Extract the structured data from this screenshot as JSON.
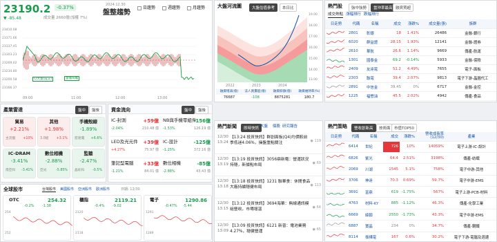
{
  "colors": {
    "up": "#e5363b",
    "down": "#1a9b4b",
    "link": "#1a56a8"
  },
  "index": {
    "value": "23190.2",
    "change_pct": "-0.37%",
    "change": "▼ -85.48",
    "volume": "成交量 2660億(加權 7%)",
    "date": "2024.12.30",
    "trend": "盤整趨勢",
    "checkboxes": [
      "日趨勢",
      "週趨勢",
      "月趨勢"
    ],
    "yticks": [
      "23410.08",
      "23371.66",
      "23337.45",
      "23303.23",
      "23269.02",
      "23234.80",
      "23200.58",
      "23166.37",
      "23132.16"
    ],
    "xticks": [
      "09:00",
      "11:00",
      "12:00",
      "13:00"
    ],
    "callouts": [
      "CI大量(成交)",
      "量價背離"
    ]
  },
  "money": {
    "title": "大盤河流圖",
    "tabs": [
      "大盤估值參考",
      "本日比"
    ],
    "xticks": [
      "2022",
      "2023",
      "2024"
    ],
    "pe_values": [
      "19.00",
      "18.00",
      "17.00",
      "16.00",
      "15.00",
      "14.00",
      "13.00"
    ],
    "headers": [
      "融資增減(億)",
      "法人買賣超(億)",
      "融資餘額(億)",
      "融資維持率(%)"
    ],
    "values": [
      "76687",
      "-108",
      "8875281",
      "180.7"
    ],
    "note": "資料日期: 2024/12"
  },
  "hot_stocks": {
    "title": "熱門股",
    "tabs": [
      "強中強勢",
      "當沖率最高",
      "融資買超"
    ],
    "subtabs": [
      "成交熱點",
      "漲幅排行",
      "跌幅排行"
    ],
    "headers": [
      "日走勢",
      "代碼",
      "名稱",
      "成交",
      "漲跌%",
      "成交量(張)",
      "族群"
    ],
    "rows": [
      [
        "2801",
        "彰銀",
        "18",
        "1.41%",
        "26486",
        "金融-銀行",
        "up"
      ],
      [
        "6020",
        "群益證",
        "28.15",
        "1.93%",
        "12141",
        "金融-證券",
        "up"
      ],
      [
        "2610",
        "華航",
        "26.6",
        "1.14%",
        "9669",
        "傳產-航運",
        "up"
      ],
      [
        "1301",
        "國泰金",
        "69.2",
        "-0.14%",
        "5933",
        "金融-保險",
        "dn"
      ],
      [
        "2409",
        "友達電",
        "51.2",
        "4.49%",
        "7655",
        "電子-面板",
        "up"
      ],
      [
        "2303",
        "聯電",
        "39.4",
        "2.07%",
        "9813",
        "電子下游-晶圓代工",
        "up"
      ],
      [
        "2891",
        "中信金",
        "39.45",
        "0%",
        "6717",
        "金融-金控",
        "mute"
      ],
      [
        "1225",
        "福懋油",
        "45.5",
        "2.02%",
        "4942",
        "傳產-食品",
        "up"
      ]
    ]
  },
  "sectors": {
    "title": "產業雷達",
    "tabs": [
      "盤中",
      "盤後"
    ],
    "cards": [
      {
        "name": "貿易",
        "pct": "+2.21%",
        "a": "主流股",
        "b": "+10%",
        "c": "+2%",
        "cls": "up"
      },
      {
        "name": "其他",
        "pct": "+1.98%",
        "a": "3.0紹",
        "b": "+3.1%",
        "c": "",
        "cls": "up"
      },
      {
        "name": "手機殼線",
        "pct": "-1.89%",
        "a": "宏達電",
        "b": "+6.6%",
        "c": "",
        "cls": "dn"
      },
      {
        "name": "IC-DRAM",
        "pct": "-3.41%",
        "a": "南亞科",
        "b": "-3.41%",
        "c": "",
        "cls": "dn"
      },
      {
        "name": "數位相機",
        "pct": "-2.88%",
        "a": "亞光",
        "b": "-5.85%",
        "c": "",
        "cls": "dn"
      },
      {
        "name": "監聽",
        "pct": "-2.47%",
        "a": "晶彩科",
        "b": "-0.5%",
        "c": "",
        "cls": "dn"
      }
    ]
  },
  "flows": {
    "title": "資金流向",
    "tabs": [
      "盤中",
      "盤後"
    ],
    "items": [
      {
        "name": "IC-封測",
        "pct": "-2.04%",
        "amt": "+59億",
        "sub": "210.48 億",
        "cls": "up"
      },
      {
        "name": "LED及光元件",
        "pct": "+4.27%",
        "amt": "+39億",
        "sub": "75.97 億",
        "cls": "up"
      },
      {
        "name": "筆記型電腦",
        "pct": "-1.21%",
        "amt": "+33億",
        "sub": "84.01 億",
        "cls": "up"
      },
      {
        "name": "NB與手機零組件",
        "pct": "-1.53%",
        "amt": "-156億",
        "sub": "126.19 億",
        "cls": "dn"
      },
      {
        "name": "IC-設計",
        "pct": "-1.25%",
        "amt": "-125億",
        "sub": "372.16 億",
        "cls": "dn"
      },
      {
        "name": "數位相機",
        "pct": "-2.88%",
        "amt": "-85億",
        "sub": "43.43 億",
        "cls": "dn"
      }
    ]
  },
  "global": {
    "title": "全球股市",
    "tabs": [
      "台灣股市",
      "美國股市",
      "亞洲股市",
      "歐洲股市"
    ],
    "date": "日期: 12/30",
    "cards": [
      {
        "name": "OTC",
        "value": "254.32",
        "pct": "-0.2%",
        "chg": "-1.38",
        "lo": "252",
        "hi": "254"
      },
      {
        "name": "櫃指",
        "value": "2119.21",
        "pct": "-0.4%",
        "chg": "-9.02",
        "lo": "2118",
        "hi": "2120"
      },
      {
        "name": "電子",
        "value": "1290.86",
        "pct": "-0.47%",
        "chg": "-5.44",
        "lo": "1289",
        "hi": "1291"
      }
    ]
  },
  "news": {
    "title": "熱門新聞",
    "tabs": [
      "即時快訊",
      "大盤",
      "個股",
      "研究報告"
    ],
    "items": [
      {
        "time": "12/30\n13:24",
        "text": "【13:24 投資快訊】群創面板(Q4)均價較前季低迷4.06%，操盤重點關注",
        "views": "119"
      },
      {
        "time": "12/30\n13:19",
        "text": "【13:19 投資快訊】3056鼎新電：營運狀況持穩，新據點布局",
        "views": "69"
      },
      {
        "time": "12/30\n13:18",
        "text": "【13:18 投資快訊】1231 聯華食：休閒食品大廠持續穩健布局",
        "views": "113"
      },
      {
        "time": "12/30\n13:15",
        "text": "【13:12 投資快訊】3694海華：無線通訊模組營收，市場增溫",
        "views": "64"
      },
      {
        "time": "12/30\n13:09",
        "text": "【13:09 投資快訊】6121 新普：電池業務4.27%，穩健營運",
        "views": "65"
      }
    ]
  },
  "strategy": {
    "title": "熱門策略",
    "tabs": [
      "營收創新高",
      "技術面",
      "市值TOP50"
    ],
    "headers": [
      "日走勢",
      "代碼",
      "名稱",
      "成交",
      "漲跌%",
      "營收成長率(12/30)",
      "產業"
    ],
    "rows": [
      [
        "6414",
        "世紀",
        "726",
        "10%",
        "14059%",
        "電子上游-IC-設計",
        "hl"
      ],
      [
        "6826",
        "紫光",
        "64.4",
        "2.51%",
        "3198%",
        "傳產-紡織",
        "up"
      ],
      [
        "2069",
        "川湖",
        "1545",
        "5.1%",
        "758%",
        "電子中游-其他",
        "up"
      ],
      [
        "3706",
        "神達",
        "70.3",
        "0.69%",
        "59.7%",
        "電子中游-EMS",
        "up"
      ],
      [
        "3691",
        "富鼎",
        "619",
        "-1.75%",
        "567%",
        "電子上游-PCB-材料",
        "dn"
      ],
      [
        "4763",
        "材料-KY",
        "885",
        "-1.12%",
        "46.3%",
        "傳產-化學工業",
        "dn"
      ],
      [
        "6669",
        "緯穎",
        "2550",
        "-1.73%",
        "43.3%",
        "電子中游-EMS",
        "dn"
      ],
      [
        "6887",
        "寶晶",
        "234",
        "0%",
        "34.7%",
        "傳產-鋼鐵",
        "mute"
      ],
      [
        "8114",
        "振樺電",
        "167",
        "0.6%",
        "30.2%",
        "電子下游-電腦及週邊",
        "up"
      ]
    ]
  }
}
